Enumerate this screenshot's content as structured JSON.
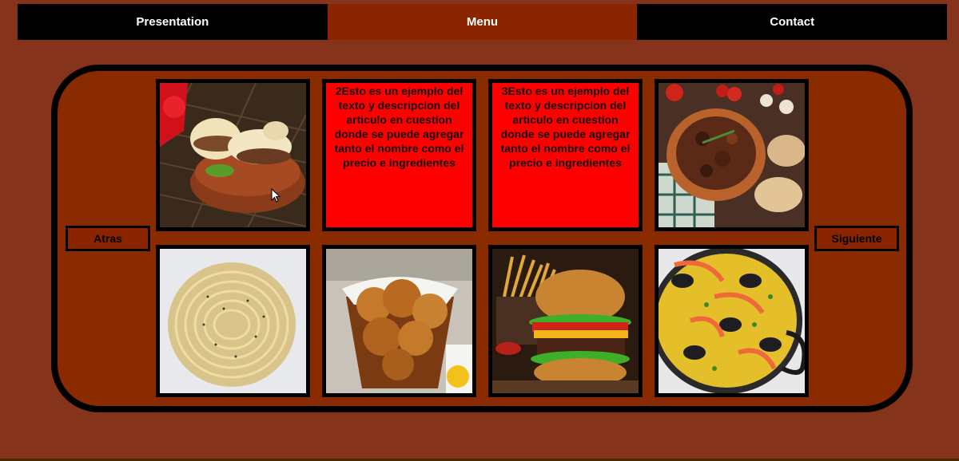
{
  "nav": {
    "items": [
      {
        "label": "Presentation"
      },
      {
        "label": "Menu"
      },
      {
        "label": "Contact"
      }
    ],
    "active_index": 1
  },
  "carousel": {
    "prev_label": "Atras",
    "next_label": "Siguiente",
    "tiles": [
      {
        "type": "image",
        "subject": "arepa-dish"
      },
      {
        "type": "text",
        "text": "2Esto es un ejemplo del texto y descripcion del articulo en cuestion donde se puede agregar tanto el nombre como el precio e ingredientes"
      },
      {
        "type": "text",
        "text": "3Esto es un ejemplo del texto y descripcion del articulo en cuestion donde se puede agregar tanto el nombre como el precio e ingredientes"
      },
      {
        "type": "image",
        "subject": "beef-stew"
      },
      {
        "type": "image",
        "subject": "spaghetti-cacio-e-pepe"
      },
      {
        "type": "image",
        "subject": "fried-chicken-basket"
      },
      {
        "type": "image",
        "subject": "burger-and-fries"
      },
      {
        "type": "image",
        "subject": "seafood-paella"
      }
    ]
  },
  "colors": {
    "page_bg": "#85331a",
    "nav_bg": "#000000",
    "nav_active_bg": "#8a2500",
    "text_tile_bg": "#ff0000"
  }
}
